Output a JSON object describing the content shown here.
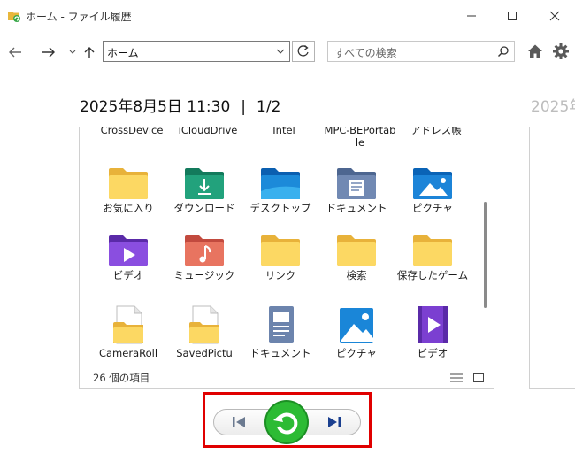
{
  "window": {
    "title": "ホーム - ファイル履歴"
  },
  "navigation": {
    "address": "ホーム",
    "search_placeholder": "すべての検索"
  },
  "snapshot": {
    "datetime": "2025年8月5日 11:30",
    "separator": "|",
    "page": "1/2",
    "next_datetime_partial": "2025年"
  },
  "files": {
    "top_row": [
      {
        "label": "CrossDevice"
      },
      {
        "label": "iCloudDrive"
      },
      {
        "label": "Intel"
      },
      {
        "label": "MPC-BEPortable"
      },
      {
        "label": "アドレス帳"
      }
    ],
    "rows": [
      [
        {
          "label": "お気に入り",
          "icon": "folder-icon"
        },
        {
          "label": "ダウンロード",
          "icon": "downloads-folder-icon"
        },
        {
          "label": "デスクトップ",
          "icon": "desktop-folder-icon"
        },
        {
          "label": "ドキュメント",
          "icon": "documents-folder-icon"
        },
        {
          "label": "ピクチャ",
          "icon": "pictures-folder-icon"
        }
      ],
      [
        {
          "label": "ビデオ",
          "icon": "videos-folder-icon"
        },
        {
          "label": "ミュージック",
          "icon": "music-folder-icon"
        },
        {
          "label": "リンク",
          "icon": "folder-icon"
        },
        {
          "label": "検索",
          "icon": "folder-icon"
        },
        {
          "label": "保存したゲーム",
          "icon": "folder-icon"
        }
      ],
      [
        {
          "label": "CameraRoll",
          "icon": "folder-file-icon"
        },
        {
          "label": "SavedPictu",
          "icon": "folder-file-icon"
        },
        {
          "label": "ドキュメント",
          "icon": "document-file-icon"
        },
        {
          "label": "ピクチャ",
          "icon": "picture-file-icon"
        },
        {
          "label": "ビデオ",
          "icon": "video-file-icon"
        }
      ]
    ]
  },
  "status": {
    "item_count": "26 個の項目"
  },
  "colors": {
    "folder_yellow": "#f8c94a",
    "folder_green": "#1f9a75",
    "folder_blue": "#1c7ed6",
    "folder_purple": "#7b3fd1",
    "folder_coral": "#e46a56",
    "restore_green": "#25b030",
    "highlight_red": "#e00000",
    "step_button_blue": "#1a3f8f"
  }
}
